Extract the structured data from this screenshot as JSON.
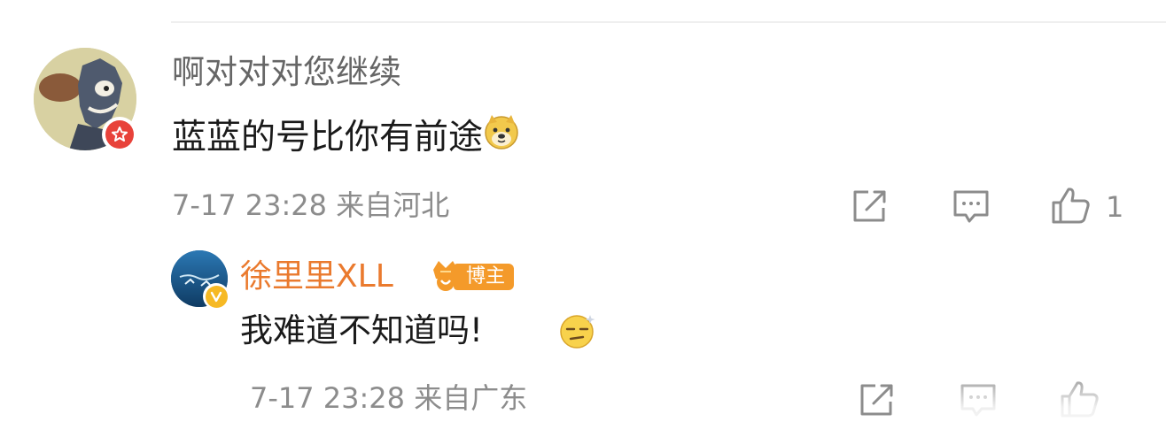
{
  "comment": {
    "username": "啊对对对您继续",
    "text": "蓝蓝的号比你有前途",
    "emoji": "doge-emoji",
    "timestamp": "7-17 23:28 来自河北",
    "like_count": "1"
  },
  "reply": {
    "username": "徐里里XLL",
    "tag": "博主",
    "text": "我难道不知道吗!",
    "emoji": "dizzy-face-emoji",
    "timestamp": "7-17 23:28 来自广东"
  },
  "colors": {
    "reply_username": "#ea7a2e",
    "tag_bg": "#f49a2a",
    "verify_red": "#e8423a",
    "verify_yellow": "#f6b924",
    "meta_gray": "#8c8c8c"
  }
}
